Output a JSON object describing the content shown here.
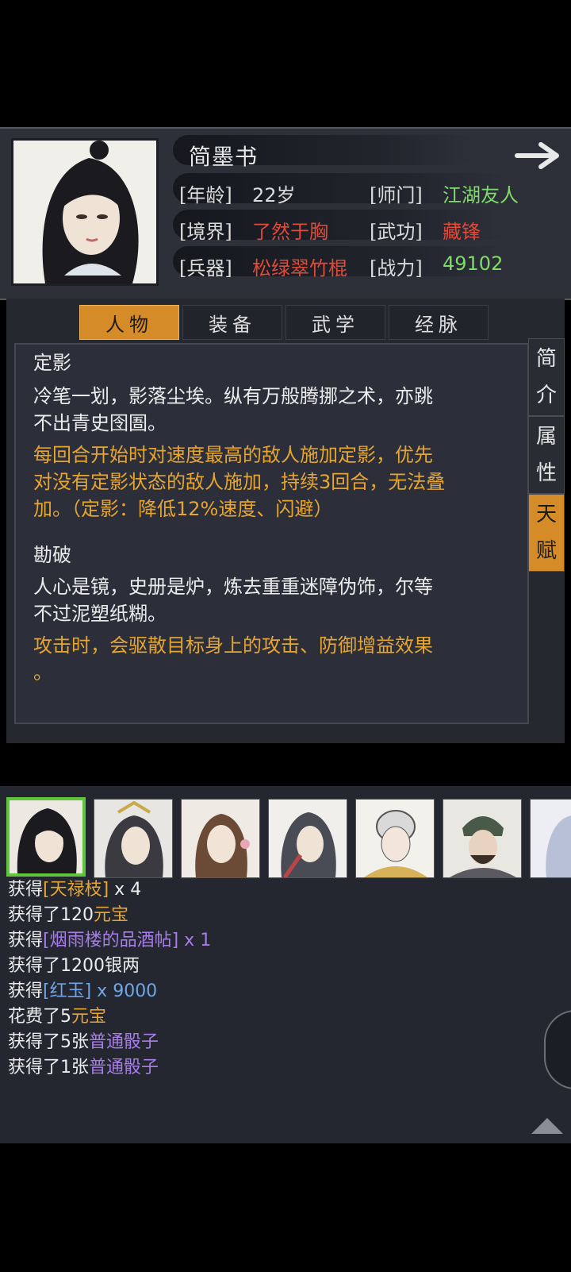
{
  "character": {
    "name": "简墨书",
    "rows": [
      {
        "label": "[年龄]",
        "value": "22岁",
        "color": "#dcdcdc"
      },
      {
        "label": "[师门]",
        "value": "江湖友人",
        "color": "#7fdb6a"
      },
      {
        "label": "[境界]",
        "value": "了然于胸",
        "color": "#e04a3a"
      },
      {
        "label": "[武功]",
        "value": "藏锋",
        "color": "#e04a3a"
      },
      {
        "label": "[兵器]",
        "value": "松绿翠竹棍",
        "color": "#e04a3a"
      },
      {
        "label": "[战力]",
        "value": "49102",
        "color": "#7fdb6a"
      }
    ]
  },
  "tabs": [
    "人物",
    "装备",
    "武学",
    "经脉"
  ],
  "active_tab": "人物",
  "side_tabs": [
    "简介",
    "属性",
    "天赋"
  ],
  "active_side_tab": "天赋",
  "talents": [
    {
      "title": "定影",
      "desc": [
        "冷笔一划，影落尘埃。纵有万般腾挪之术，亦跳",
        "不出青史囹圄。"
      ],
      "effect": [
        "每回合开始时对速度最高的敌人施加定影，优先",
        "对没有定影状态的敌人施加，持续3回合，无法叠",
        "加。（定影：降低12%速度、闪避）"
      ]
    },
    {
      "title": "勘破",
      "desc": [
        "人心是镜，史册是炉，炼去重重迷障伪饰，尔等",
        "不过泥塑纸糊。"
      ],
      "effect": [
        "攻击时，会驱散目标身上的攻击、防御增益效果",
        "。"
      ]
    }
  ],
  "log": [
    {
      "parts": [
        {
          "t": "获得",
          "c": "white"
        },
        {
          "t": "[天禄枝]",
          "c": "orange"
        },
        {
          "t": " x 4",
          "c": "white"
        }
      ]
    },
    {
      "parts": [
        {
          "t": "获得了120",
          "c": "white"
        },
        {
          "t": "元宝",
          "c": "orange"
        }
      ]
    },
    {
      "parts": [
        {
          "t": "获得",
          "c": "white"
        },
        {
          "t": "[烟雨楼的品酒帖]",
          "c": "purple"
        },
        {
          "t": " x 1",
          "c": "white"
        }
      ]
    },
    {
      "parts": [
        {
          "t": "获得了1200银两",
          "c": "white"
        }
      ]
    },
    {
      "parts": [
        {
          "t": "获得",
          "c": "white"
        },
        {
          "t": "[红玉]",
          "c": "blue"
        },
        {
          "t": " x 9000",
          "c": "blue"
        }
      ]
    },
    {
      "parts": [
        {
          "t": "花费了5",
          "c": "white"
        },
        {
          "t": "元宝",
          "c": "orange"
        }
      ]
    },
    {
      "parts": [
        {
          "t": "获得了5张",
          "c": "white"
        },
        {
          "t": "普通骰子",
          "c": "purple"
        }
      ]
    },
    {
      "parts": [
        {
          "t": "获得了1张",
          "c": "white"
        },
        {
          "t": "普通骰子",
          "c": "purple"
        }
      ]
    }
  ],
  "icons": {
    "next": "arrow-right-icon",
    "scroll": "triangle-up-icon"
  }
}
